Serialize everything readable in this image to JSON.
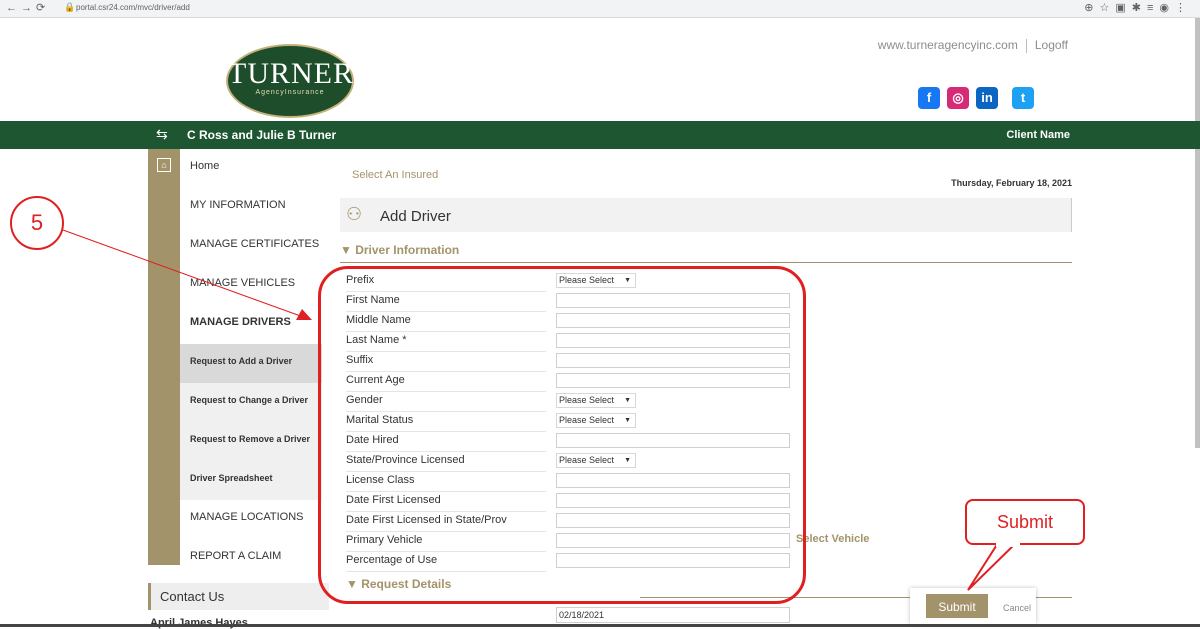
{
  "browser": {
    "url": "portal.csr24.com/mvc/driver/add"
  },
  "header": {
    "site_link": "www.turneragencyinc.com",
    "logoff": "Logoff",
    "logo_main": "TURNER",
    "logo_sub": "AgencyInsurance",
    "social": {
      "facebook": "f",
      "instagram": "◎",
      "linkedin": "in",
      "twitter": "t"
    }
  },
  "greenbar": {
    "insured": "C Ross and Julie B Turner",
    "client_name": "Client Name"
  },
  "sidebar": {
    "items": [
      {
        "label": "Home"
      },
      {
        "label": "MY INFORMATION"
      },
      {
        "label": "MANAGE CERTIFICATES"
      },
      {
        "label": "MANAGE VEHICLES"
      },
      {
        "label": "MANAGE DRIVERS"
      },
      {
        "label": "Request to Add a Driver"
      },
      {
        "label": "Request to Change a Driver"
      },
      {
        "label": "Request to Remove a Driver"
      },
      {
        "label": "Driver Spreadsheet"
      },
      {
        "label": "MANAGE LOCATIONS"
      },
      {
        "label": "REPORT A CLAIM"
      }
    ],
    "contact_title": "Contact Us",
    "contact_name": "April James Hayes"
  },
  "main": {
    "select_insured": "Select An Insured",
    "date": "Thursday, February 18, 2021",
    "panel_title": "Add Driver",
    "section_title": "▼ Driver Information",
    "fields": [
      {
        "label": "Prefix",
        "value": "Please Select"
      },
      {
        "label": "First Name",
        "value": ""
      },
      {
        "label": "Middle Name",
        "value": ""
      },
      {
        "label": "Last Name *",
        "value": ""
      },
      {
        "label": "Suffix",
        "value": ""
      },
      {
        "label": "Current Age",
        "value": ""
      },
      {
        "label": "Gender",
        "value": "Please Select"
      },
      {
        "label": "Marital Status",
        "value": "Please Select"
      },
      {
        "label": "Date Hired",
        "value": ""
      },
      {
        "label": "State/Province Licensed",
        "value": "Please Select"
      },
      {
        "label": "License Class",
        "value": ""
      },
      {
        "label": "Date First Licensed",
        "value": ""
      },
      {
        "label": "Date First Licensed in State/Prov",
        "value": ""
      },
      {
        "label": "Primary Vehicle",
        "value": ""
      },
      {
        "label": "Percentage of Use",
        "value": ""
      }
    ],
    "select_vehicle": "Select Vehicle",
    "request_details": "▼ Request Details",
    "request_date": "02/18/2021",
    "submit": "Submit",
    "cancel": "Cancel"
  },
  "annotations": {
    "step_number": "5",
    "callout": "Submit"
  }
}
